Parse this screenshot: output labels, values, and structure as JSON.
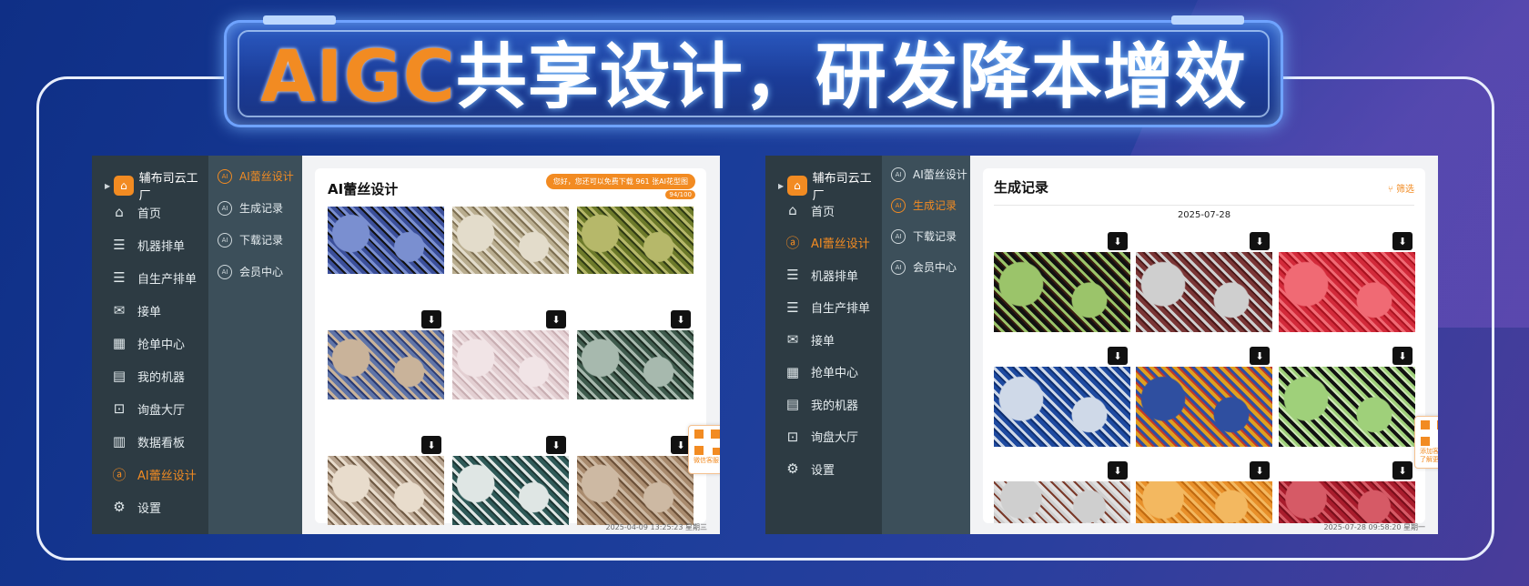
{
  "banner": {
    "title_em": "AIGC",
    "title_rest": "共享设计，研发降本增效"
  },
  "colors": {
    "accent": "#f28b22",
    "nav_dark": "#2d3b43",
    "nav_mid": "#3c4f5a"
  },
  "left": {
    "brand": "辅布司云工厂",
    "nav": [
      {
        "label": "首页",
        "icon": "home-icon"
      },
      {
        "label": "机器排单",
        "icon": "list-icon"
      },
      {
        "label": "自生产排单",
        "icon": "list-icon"
      },
      {
        "label": "接单",
        "icon": "mail-icon"
      },
      {
        "label": "抢单中心",
        "icon": "grid-icon"
      },
      {
        "label": "我的机器",
        "icon": "machine-icon"
      },
      {
        "label": "询盘大厅",
        "icon": "inbox-icon"
      },
      {
        "label": "数据看板",
        "icon": "chart-icon"
      },
      {
        "label": "AI蕾丝设计",
        "icon": "ai-icon",
        "active": true
      },
      {
        "label": "设置",
        "icon": "gear-icon"
      }
    ],
    "subnav": [
      {
        "label": "AI蕾丝设计",
        "active": true
      },
      {
        "label": "生成记录"
      },
      {
        "label": "下载记录"
      },
      {
        "label": "会员中心"
      }
    ],
    "page_title": "AI蕾丝设计",
    "notice": "您好，您还可以免费下载 961 张AI花型图",
    "quota": "94/100",
    "qr_label": "微信客服",
    "footer": "2025-04-09 13:25:23 星期三"
  },
  "right": {
    "brand": "辅布司云工厂",
    "nav": [
      {
        "label": "首页",
        "icon": "home-icon"
      },
      {
        "label": "AI蕾丝设计",
        "icon": "ai-icon",
        "active": true
      },
      {
        "label": "机器排单",
        "icon": "list-icon"
      },
      {
        "label": "自生产排单",
        "icon": "list-icon"
      },
      {
        "label": "接单",
        "icon": "mail-icon"
      },
      {
        "label": "抢单中心",
        "icon": "grid-icon"
      },
      {
        "label": "我的机器",
        "icon": "machine-icon"
      },
      {
        "label": "询盘大厅",
        "icon": "inbox-icon"
      },
      {
        "label": "设置",
        "icon": "gear-icon"
      }
    ],
    "subnav": [
      {
        "label": "AI蕾丝设计"
      },
      {
        "label": "生成记录",
        "active": true
      },
      {
        "label": "下载记录"
      },
      {
        "label": "会员中心"
      }
    ],
    "page_title": "生成记录",
    "filter": "筛选",
    "date": "2025-07-28",
    "qr_label": "添加客服\n了解更多",
    "footer": "2025-07-28 09:58:20 星期一"
  }
}
